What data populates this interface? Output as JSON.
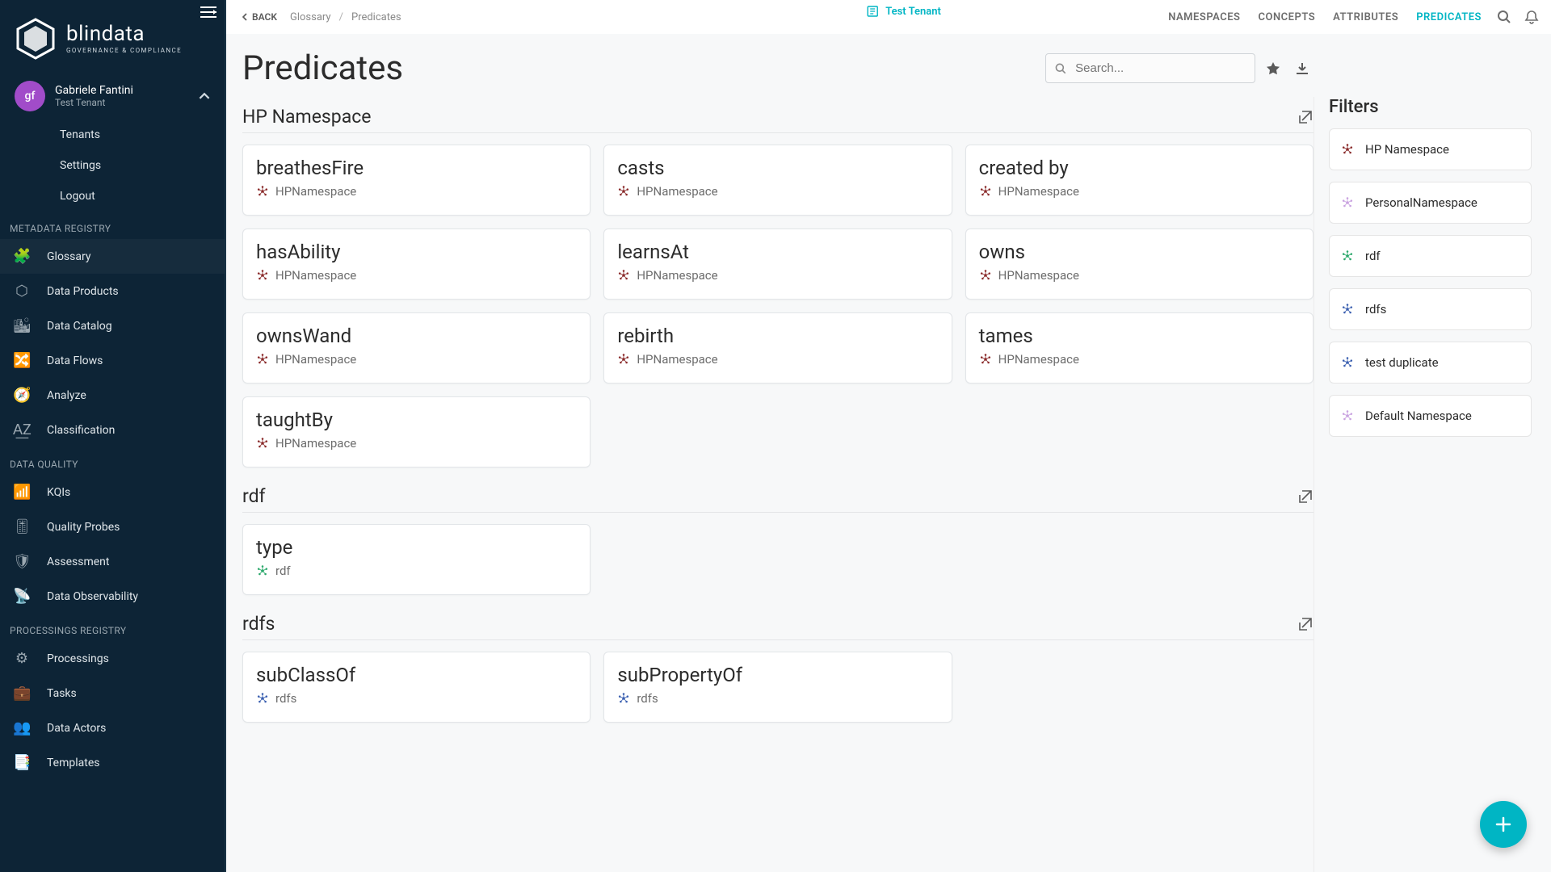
{
  "brand": {
    "name": "blindata",
    "tagline": "GOVERNANCE & COMPLIANCE"
  },
  "user": {
    "initials": "gf",
    "name": "Gabriele Fantini",
    "tenant": "Test Tenant"
  },
  "sidebar": {
    "user_menu": [
      {
        "label": "Tenants"
      },
      {
        "label": "Settings"
      },
      {
        "label": "Logout"
      }
    ],
    "sections": [
      {
        "title": "METADATA REGISTRY",
        "items": [
          {
            "label": "Glossary",
            "icon": "puzzle"
          },
          {
            "label": "Data Products",
            "icon": "hexagon"
          },
          {
            "label": "Data Catalog",
            "icon": "city"
          },
          {
            "label": "Data Flows",
            "icon": "flow"
          },
          {
            "label": "Analyze",
            "icon": "compass"
          },
          {
            "label": "Classification",
            "icon": "az"
          }
        ]
      },
      {
        "title": "DATA QUALITY",
        "items": [
          {
            "label": "KQIs",
            "icon": "signal"
          },
          {
            "label": "Quality Probes",
            "icon": "sliders"
          },
          {
            "label": "Assessment",
            "icon": "shield"
          },
          {
            "label": "Data Observability",
            "icon": "radar"
          }
        ]
      },
      {
        "title": "PROCESSINGS REGISTRY",
        "items": [
          {
            "label": "Processings",
            "icon": "gears"
          },
          {
            "label": "Tasks",
            "icon": "briefcase"
          },
          {
            "label": "Data Actors",
            "icon": "users"
          },
          {
            "label": "Templates",
            "icon": "layers"
          }
        ]
      }
    ]
  },
  "topbar": {
    "back": "BACK",
    "breadcrumbs": [
      "Glossary",
      "Predicates"
    ],
    "tenant_label": "Test Tenant",
    "tabs": [
      {
        "label": "NAMESPACES"
      },
      {
        "label": "CONCEPTS"
      },
      {
        "label": "ATTRIBUTES"
      },
      {
        "label": "PREDICATES",
        "active": true
      }
    ]
  },
  "page": {
    "title": "Predicates",
    "search_placeholder": "Search..."
  },
  "namespaces": [
    {
      "title": "HP Namespace",
      "icon_color": "#8a2b2b",
      "predicates": [
        {
          "name": "breathesFire",
          "ns": "HPNamespace"
        },
        {
          "name": "casts",
          "ns": "HPNamespace"
        },
        {
          "name": "created by",
          "ns": "HPNamespace"
        },
        {
          "name": "hasAbility",
          "ns": "HPNamespace"
        },
        {
          "name": "learnsAt",
          "ns": "HPNamespace"
        },
        {
          "name": "owns",
          "ns": "HPNamespace"
        },
        {
          "name": "ownsWand",
          "ns": "HPNamespace"
        },
        {
          "name": "rebirth",
          "ns": "HPNamespace"
        },
        {
          "name": "tames",
          "ns": "HPNamespace"
        },
        {
          "name": "taughtBy",
          "ns": "HPNamespace"
        }
      ]
    },
    {
      "title": "rdf",
      "icon_color": "#2ba86b",
      "predicates": [
        {
          "name": "type",
          "ns": "rdf"
        }
      ]
    },
    {
      "title": "rdfs",
      "icon_color": "#3a5fb0",
      "predicates": [
        {
          "name": "subClassOf",
          "ns": "rdfs"
        },
        {
          "name": "subPropertyOf",
          "ns": "rdfs"
        }
      ]
    }
  ],
  "filters": {
    "title": "Filters",
    "items": [
      {
        "label": "HP Namespace",
        "color": "#8a2b2b"
      },
      {
        "label": "PersonalNamespace",
        "color": "#c9a2e0"
      },
      {
        "label": "rdf",
        "color": "#2ba86b"
      },
      {
        "label": "rdfs",
        "color": "#3a5fb0"
      },
      {
        "label": "test duplicate",
        "color": "#3a5fb0"
      },
      {
        "label": "Default Namespace",
        "color": "#c9a2e0"
      }
    ]
  },
  "icons": {
    "puzzle": "🧩",
    "hexagon": "⬡",
    "city": "🏙",
    "flow": "🔀",
    "compass": "🧭",
    "az": "A͟Z",
    "signal": "📶",
    "sliders": "🎚",
    "shield": "🛡",
    "radar": "📡",
    "gears": "⚙",
    "briefcase": "💼",
    "users": "👥",
    "layers": "📑"
  }
}
